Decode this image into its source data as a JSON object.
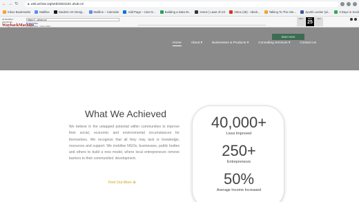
{
  "browser": {
    "url": "web.archive.org/web/20221103..ahub.co/",
    "bookmarks": [
      {
        "label": "Inbox Bookmarks",
        "color": "#f2a33a"
      },
      {
        "label": "Mailline",
        "color": "#5b8def"
      },
      {
        "label": "Student UX Desig...",
        "color": "#1a1a1a"
      },
      {
        "label": "Mailline – Calendar",
        "color": "#5b8def"
      },
      {
        "label": "Add Page – User E...",
        "color": "#0b6fd8"
      },
      {
        "label": "Building a Data W...",
        "color": "#2c9d57"
      },
      {
        "label": "Home | Laws of UX",
        "color": "#333333"
      },
      {
        "label": "Inbox (45) - sbrek...",
        "color": "#d93025"
      },
      {
        "label": "Talking To The Inte...",
        "color": "#f2a33a"
      },
      {
        "label": "Jyoshi Leeker (al...",
        "color": "#3b5998"
      },
      {
        "label": "3 Days in Seville...",
        "color": "#34a853"
      }
    ]
  },
  "wayback": {
    "logo_top": "INTERNET ARCHIVE",
    "logo_main": "WaybackMachine",
    "url": "https://...ahub.co/",
    "captures": "6 captures",
    "range": "27 Nov 2021 - 3 Dec 2022",
    "go": "Go",
    "cal": {
      "prev": "NOV",
      "day": "25",
      "cur_month": "DEC",
      "year": "2022",
      "next": "JAN"
    }
  },
  "hero": {
    "cta": "Start Here",
    "nav": [
      {
        "label": "Home",
        "active": true
      },
      {
        "label": "About ▾",
        "active": false
      },
      {
        "label": "Businesses & Products ▾",
        "active": false
      },
      {
        "label": "Consulting Services ▾",
        "active": false
      },
      {
        "label": "Contact Us",
        "active": false
      }
    ]
  },
  "achieved": {
    "title": "What We Achieved",
    "description": "We believe in the untapped potential within communities to improve their social, economic and environmental circumstances for themselves. We recognize that all they may lack is knowledge, resources and support. We mobilise NGOs, businesses, public bodies and others to build a new model, where local entrepreneurs remove barriers to their communities' development.",
    "link": "Find Out More ⊕"
  },
  "stats": [
    {
      "value": "40,000+",
      "label": "Lives Improved"
    },
    {
      "value": "250+",
      "label": "Entrepreneurs"
    },
    {
      "value": "50%",
      "label": "Average Income Increased"
    }
  ]
}
